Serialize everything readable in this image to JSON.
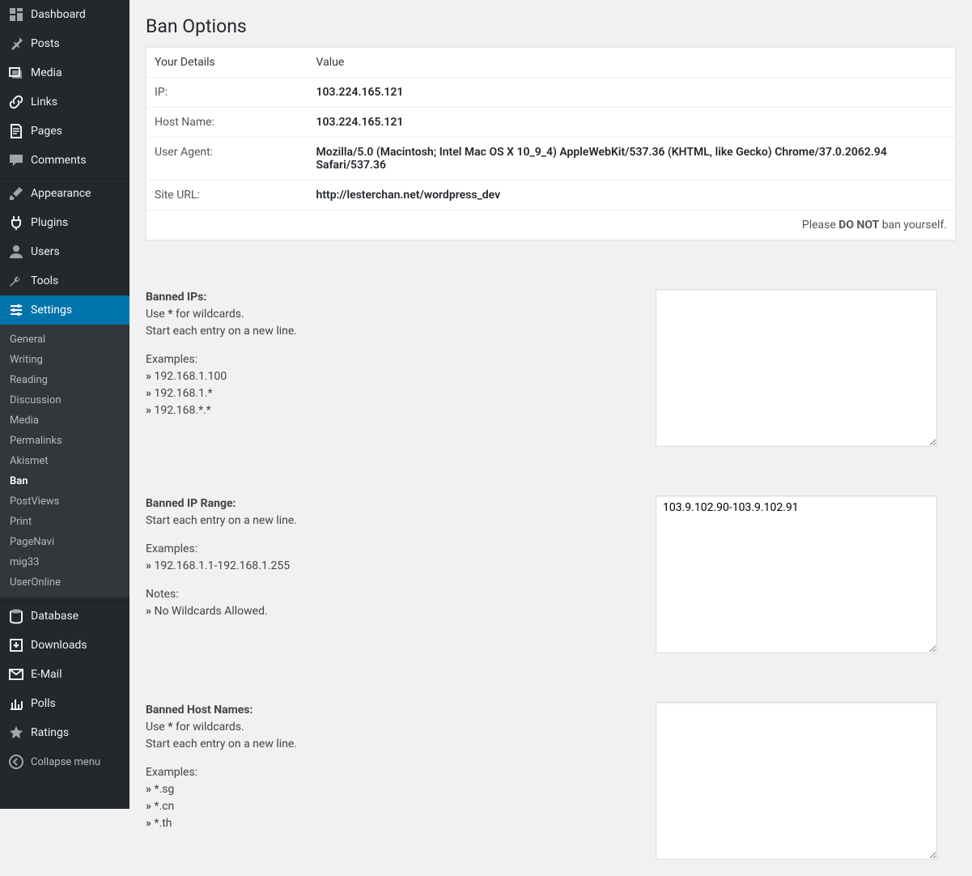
{
  "sidebar": {
    "items": [
      {
        "label": "Dashboard",
        "icon": "dashboard"
      },
      {
        "label": "Posts",
        "icon": "pin"
      },
      {
        "label": "Media",
        "icon": "media"
      },
      {
        "label": "Links",
        "icon": "link"
      },
      {
        "label": "Pages",
        "icon": "page"
      },
      {
        "label": "Comments",
        "icon": "comment"
      },
      {
        "label": "Appearance",
        "icon": "brush"
      },
      {
        "label": "Plugins",
        "icon": "plug"
      },
      {
        "label": "Users",
        "icon": "user"
      },
      {
        "label": "Tools",
        "icon": "wrench"
      },
      {
        "label": "Settings",
        "icon": "settings",
        "current": true
      },
      {
        "label": "Database",
        "icon": "database"
      },
      {
        "label": "Downloads",
        "icon": "download"
      },
      {
        "label": "E-Mail",
        "icon": "mail"
      },
      {
        "label": "Polls",
        "icon": "chart"
      },
      {
        "label": "Ratings",
        "icon": "star"
      }
    ],
    "settings_submenu": [
      "General",
      "Writing",
      "Reading",
      "Discussion",
      "Media",
      "Permalinks",
      "Akismet",
      "Ban",
      "PostViews",
      "Print",
      "PageNavi",
      "mig33",
      "UserOnline"
    ],
    "settings_current": "Ban",
    "collapse_label": "Collapse menu"
  },
  "page": {
    "title": "Ban Options",
    "details_header": {
      "col1": "Your Details",
      "col2": "Value"
    },
    "details": [
      {
        "label": "IP:",
        "value": "103.224.165.121"
      },
      {
        "label": "Host Name:",
        "value": "103.224.165.121"
      },
      {
        "label": "User Agent:",
        "value": "Mozilla/5.0 (Macintosh; Intel Mac OS X 10_9_4) AppleWebKit/537.36 (KHTML, like Gecko) Chrome/37.0.2062.94 Safari/537.36"
      },
      {
        "label": "Site URL:",
        "value": "http://lesterchan.net/wordpress_dev"
      }
    ],
    "footnote_pre": "Please ",
    "footnote_strong": "DO NOT",
    "footnote_post": " ban yourself.",
    "sections": {
      "banned_ips": {
        "title": "Banned IPs:",
        "use_pre": "Use ",
        "use_wild": "*",
        "use_post": " for wildcards.",
        "newline": "Start each entry on a new line.",
        "examples_label": "Examples:",
        "examples": [
          "192.168.1.100",
          "192.168.1.*",
          "192.168.*.*"
        ],
        "value": ""
      },
      "banned_ip_range": {
        "title": "Banned IP Range:",
        "newline": "Start each entry on a new line.",
        "examples_label": "Examples:",
        "examples": [
          "192.168.1.1-192.168.1.255"
        ],
        "notes_label": "Notes:",
        "notes": [
          "No Wildcards Allowed."
        ],
        "value": "103.9.102.90-103.9.102.91"
      },
      "banned_host_names": {
        "title": "Banned Host Names:",
        "use_pre": "Use ",
        "use_wild": "*",
        "use_post": " for wildcards.",
        "newline": "Start each entry on a new line.",
        "examples_label": "Examples:",
        "examples": [
          "*.sg",
          "*.cn",
          "*.th"
        ],
        "value": ""
      }
    }
  }
}
